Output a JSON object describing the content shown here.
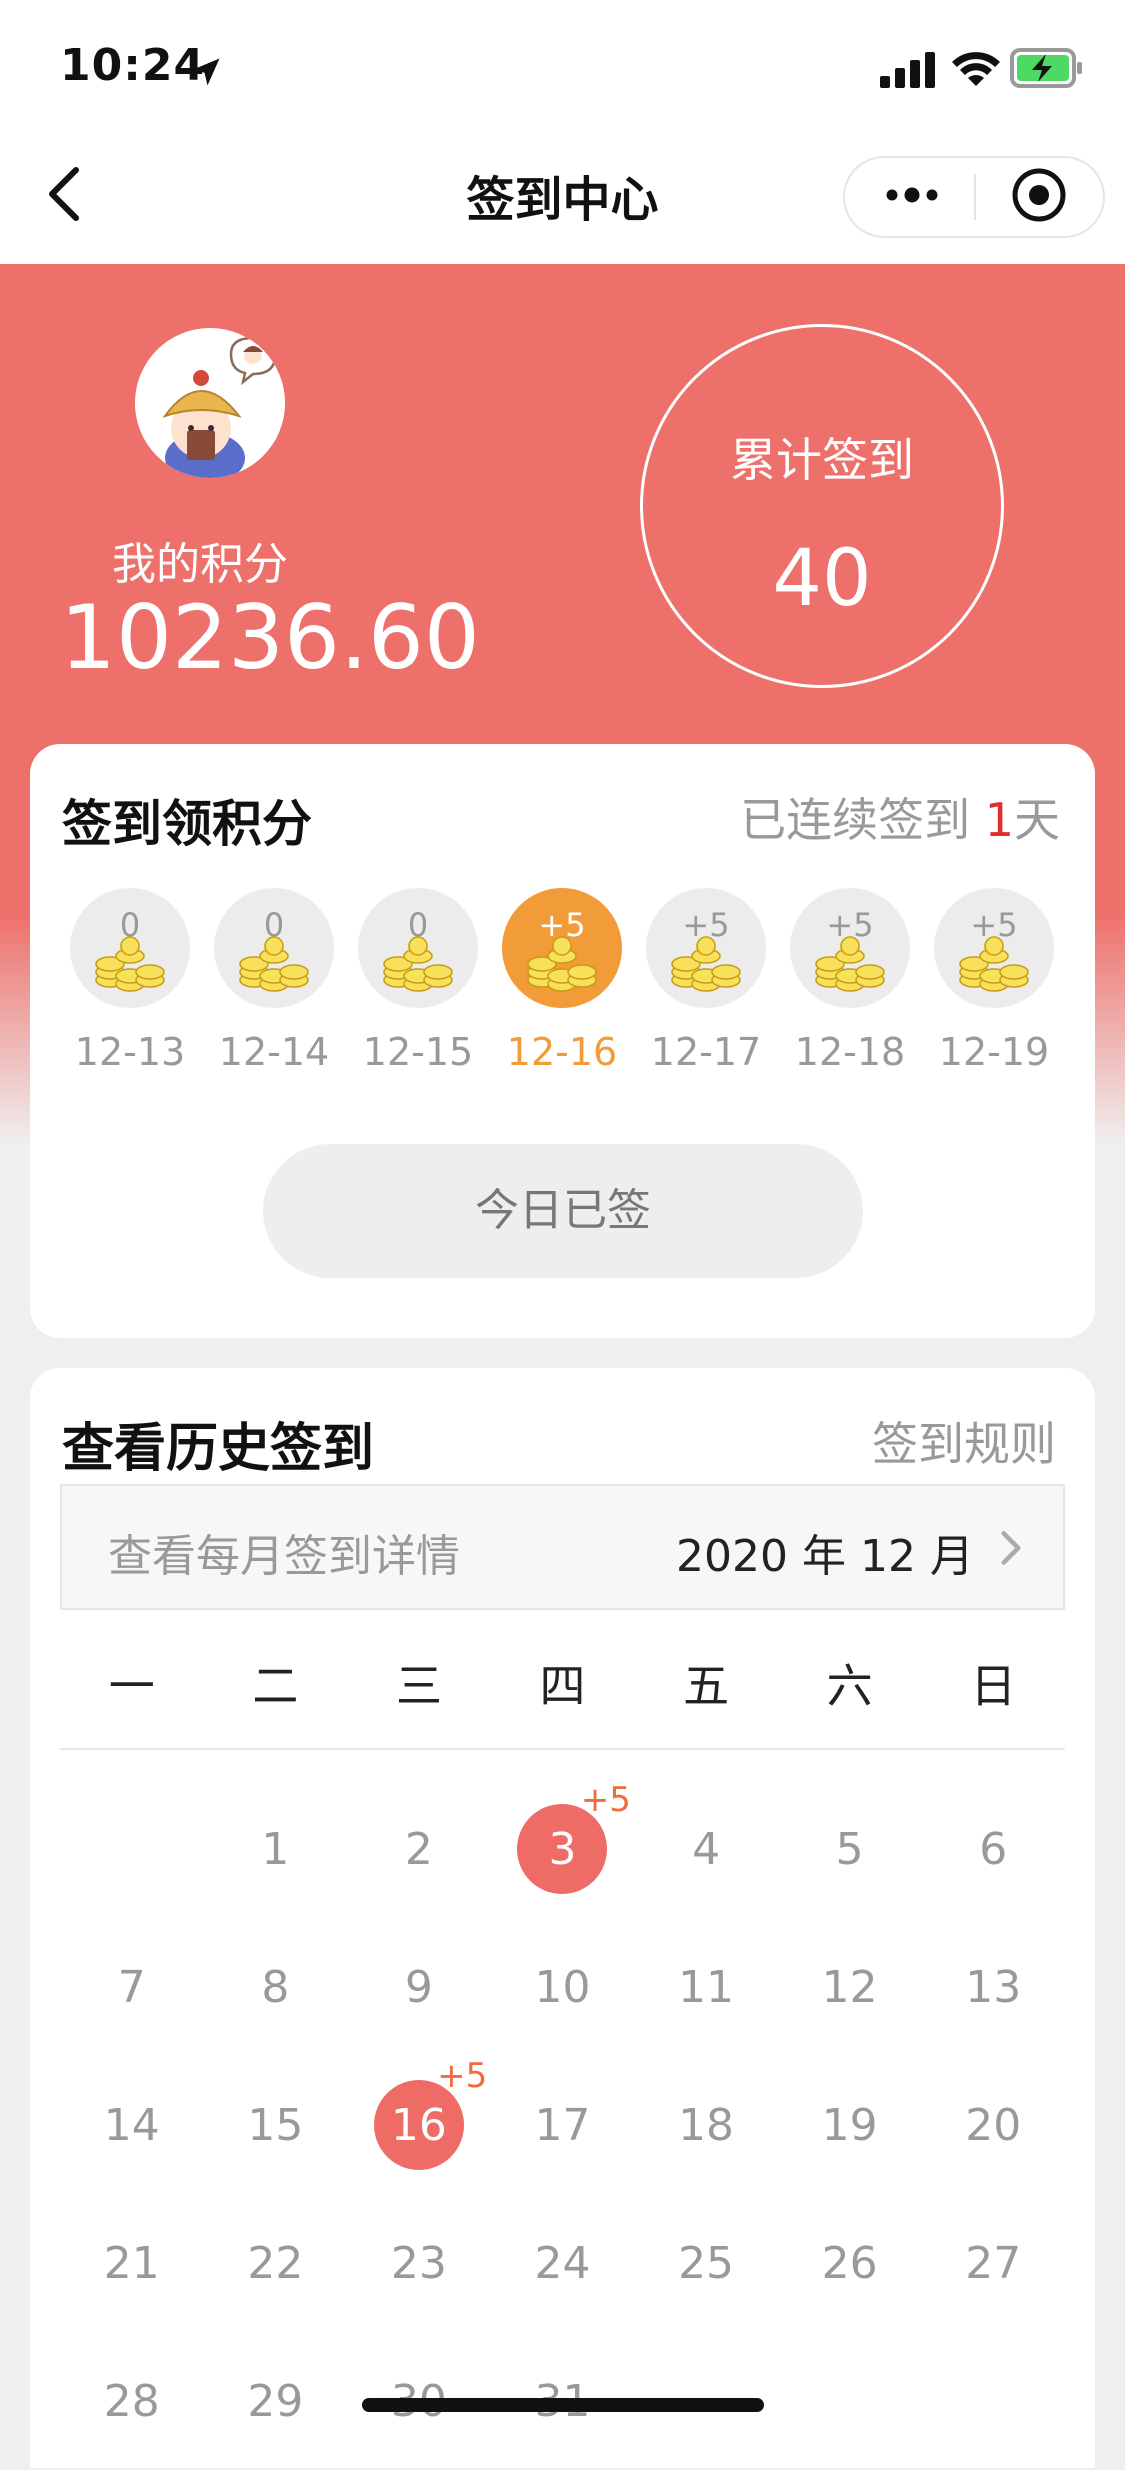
{
  "status_bar": {
    "time": "10:24"
  },
  "nav": {
    "title": "签到中心"
  },
  "header": {
    "points_label": "我的积分",
    "points_value": "10236.60",
    "total_label": "累计签到",
    "total_value": "40"
  },
  "checkin": {
    "title": "签到领积分",
    "streak_prefix": "已连续签到 ",
    "streak_days": "1",
    "streak_suffix": "天",
    "days": [
      {
        "points": "0",
        "date": "12-13",
        "active": false
      },
      {
        "points": "0",
        "date": "12-14",
        "active": false
      },
      {
        "points": "0",
        "date": "12-15",
        "active": false
      },
      {
        "points": "+5",
        "date": "12-16",
        "active": true
      },
      {
        "points": "+5",
        "date": "12-17",
        "active": false
      },
      {
        "points": "+5",
        "date": "12-18",
        "active": false
      },
      {
        "points": "+5",
        "date": "12-19",
        "active": false
      }
    ],
    "button_label": "今日已签"
  },
  "history": {
    "title": "查看历史签到",
    "rules_label": "签到规则",
    "month_hint": "查看每月签到详情",
    "month_value": "2020 年 12 月",
    "weekdays": [
      "一",
      "二",
      "三",
      "四",
      "五",
      "六",
      "日"
    ],
    "leading_blanks": 1,
    "dates": [
      "1",
      "2",
      "3",
      "4",
      "5",
      "6",
      "7",
      "8",
      "9",
      "10",
      "11",
      "12",
      "13",
      "14",
      "15",
      "16",
      "17",
      "18",
      "19",
      "20",
      "21",
      "22",
      "23",
      "24",
      "25",
      "26",
      "27",
      "28",
      "29",
      "30",
      "31"
    ],
    "signed": [
      {
        "date": "3",
        "bonus": "+5"
      },
      {
        "date": "16",
        "bonus": "+5"
      }
    ]
  },
  "colors": {
    "hero": "#ee706b",
    "accent_orange": "#f19c38",
    "signed_day": "#ee6b66",
    "streak_num": "#e02d2d"
  }
}
